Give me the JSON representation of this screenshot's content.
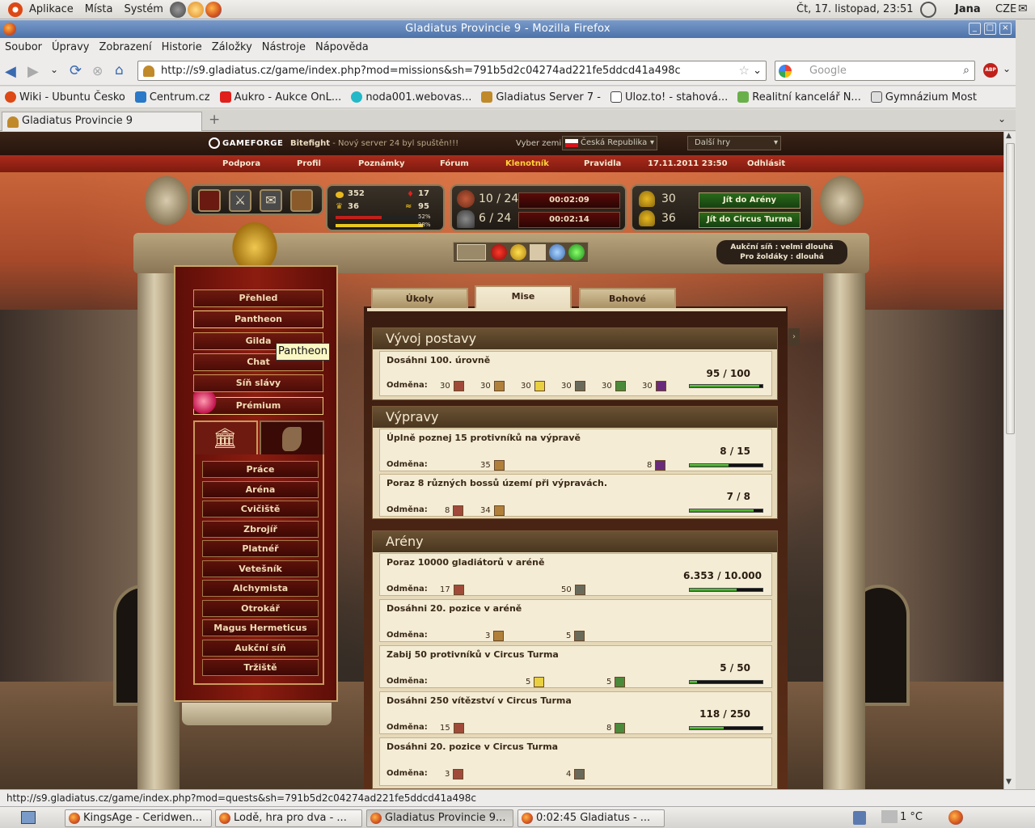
{
  "gnome": {
    "apps": "Aplikace",
    "places": "Místa",
    "system": "Systém",
    "datetime": "Čt, 17. listopad, 23:51",
    "user": "Jana",
    "lang": "CZE"
  },
  "window": {
    "title": "Gladiatus Provincie 9 - Mozilla Firefox"
  },
  "menu": [
    "Soubor",
    "Úpravy",
    "Zobrazení",
    "Historie",
    "Záložky",
    "Nástroje",
    "Nápověda"
  ],
  "url": "http://s9.gladiatus.cz/game/index.php?mod=missions&sh=791b5d2c04274ad221fe5ddcd41a498c",
  "search_placeholder": "Google",
  "bookmarks": [
    "Wiki - Ubuntu Česko",
    "Centrum.cz",
    "Aukro - Aukce OnL...",
    "noda001.webovas...",
    "Gladiatus Server 7 -",
    "Uloz.to! - stahová...",
    "Realitní kancelář N...",
    "Gymnázium Most"
  ],
  "tab": "Gladiatus Provincie 9",
  "status": "http://s9.gladiatus.cz/game/index.php?mod=quests&sh=791b5d2c04274ad221fe5ddcd41a498c",
  "taskbar": [
    "KingsAge - Ceridwen...",
    "Lodě, hra pro dva - ...",
    "Gladiatus Provincie 9...",
    "0:02:45 Gladiatus - ..."
  ],
  "weather": "1 °C",
  "game": {
    "gf_logo": "GAMEFORGE",
    "news_bold": "Bitefight",
    "news": " - Nový server 24 byl spuštěn!!!",
    "country_label": "Vyber zemi:",
    "country": "Česká Republika",
    "more_games": "Další hry",
    "nav": [
      "Podpora",
      "Profil",
      "Poznámky",
      "Fórum",
      "Klenotník",
      "Pravidla",
      "17.11.2011 23:50",
      "Odhlásit"
    ],
    "gold": "352",
    "rubies": "17",
    "level": "36",
    "rank": "95",
    "hp_pct": "52%",
    "xp_pct": "98%",
    "exp_count": "10 / 24",
    "exp_timer": "00:02:09",
    "dung_count": "6 / 24",
    "dung_timer": "00:02:14",
    "arena_pts": "30",
    "ct_pts": "36",
    "btn_arena": "Jít do Arény",
    "btn_ct": "Jít do Circus Turma",
    "auction1": "Aukční síň : velmi dlouhá",
    "auction2": "Pro žoldáky : dlouhá",
    "left_menu": [
      "Přehled",
      "Pantheon",
      "Gilda",
      "Chat",
      "Síň slávy",
      "Prémium"
    ],
    "sub_menu": [
      "Práce",
      "Aréna",
      "Cvičiště",
      "Zbrojíř",
      "Platnéř",
      "Vetešník",
      "Alchymista",
      "Otrokář",
      "Magus Hermeticus",
      "Aukční síň",
      "Tržiště"
    ],
    "tooltip": "Pantheon",
    "tabs": [
      "Úkoly",
      "Mise",
      "Bohové"
    ],
    "reward_label": "Odměna:",
    "sections": [
      {
        "title": "Vývoj postavy",
        "quests": [
          {
            "title": "Dosáhni 100. úrovně",
            "progress": "95 / 100",
            "fill": 0.95,
            "rewards": [
              "30",
              "30",
              "30",
              "30",
              "30",
              "30"
            ]
          }
        ]
      },
      {
        "title": "Výpravy",
        "quests": [
          {
            "title": "Úplně poznej 15 protivníků na výpravě",
            "progress": "8 / 15",
            "fill": 0.53,
            "rewards": [
              "35",
              "8"
            ]
          },
          {
            "title": "Poraz 8 různých bossů území při výpravách.",
            "progress": "7 / 8",
            "fill": 0.88,
            "rewards": [
              "8",
              "34"
            ]
          }
        ]
      },
      {
        "title": "Arény",
        "quests": [
          {
            "title": "Poraz 10000 gladiátorů v aréně",
            "progress": "6.353 / 10.000",
            "fill": 0.64,
            "rewards": [
              "17",
              "50"
            ]
          },
          {
            "title": "Dosáhni 20. pozice v aréně",
            "progress": "",
            "fill": 0,
            "rewards": [
              "3",
              "5"
            ]
          },
          {
            "title": "Zabij 50 protivníků v Circus Turma",
            "progress": "5 / 50",
            "fill": 0.1,
            "rewards": [
              "5",
              "5"
            ]
          },
          {
            "title": "Dosáhni 250 vítězství v Circus Turma",
            "progress": "118 / 250",
            "fill": 0.47,
            "rewards": [
              "15",
              "8"
            ]
          },
          {
            "title": "Dosáhni 20. pozice v Circus Turma",
            "progress": "",
            "fill": 0,
            "rewards": [
              "3",
              "4"
            ]
          }
        ]
      }
    ]
  }
}
